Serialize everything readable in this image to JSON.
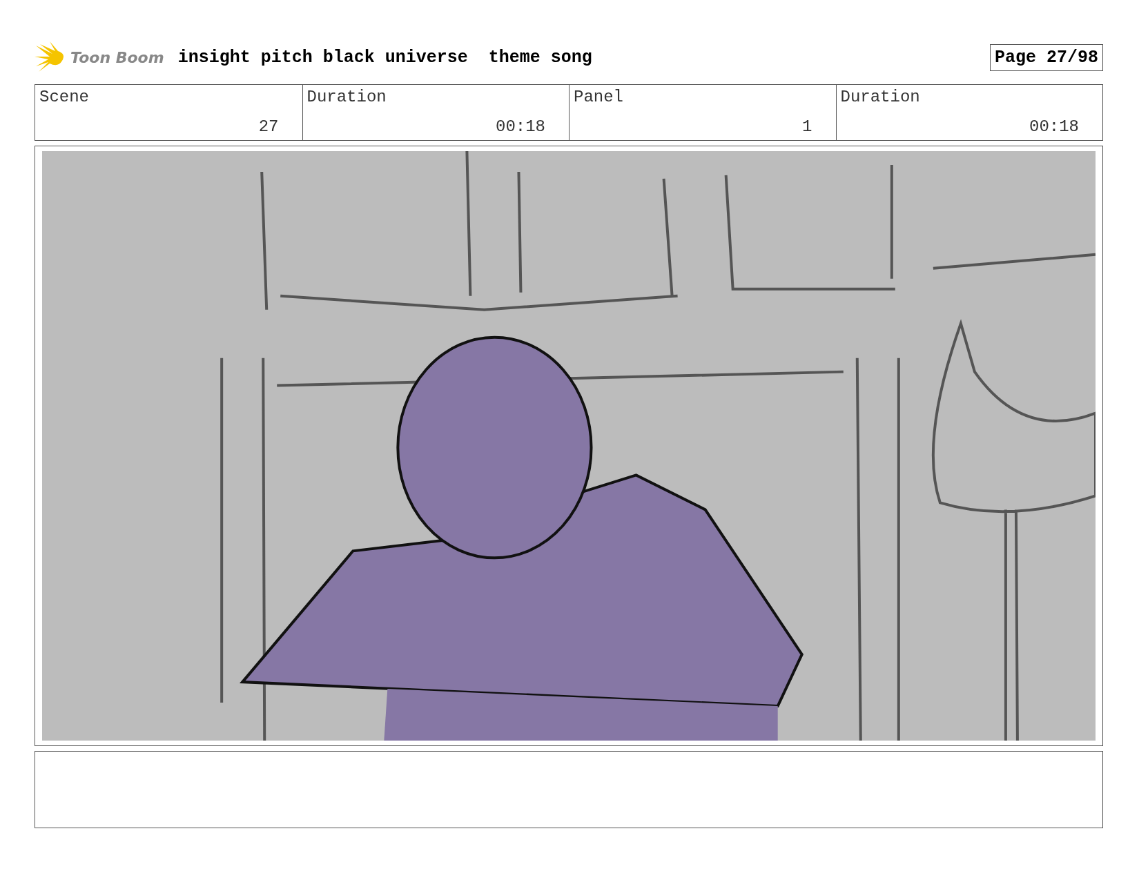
{
  "header": {
    "logo": "Toon Boom",
    "title": "insight pitch black universe  theme song",
    "page": "Page 27/98"
  },
  "fields": [
    {
      "label": "Scene",
      "value": "27"
    },
    {
      "label": "Duration",
      "value": "00:18"
    },
    {
      "label": "Panel",
      "value": "1"
    },
    {
      "label": "Duration",
      "value": "00:18"
    }
  ]
}
